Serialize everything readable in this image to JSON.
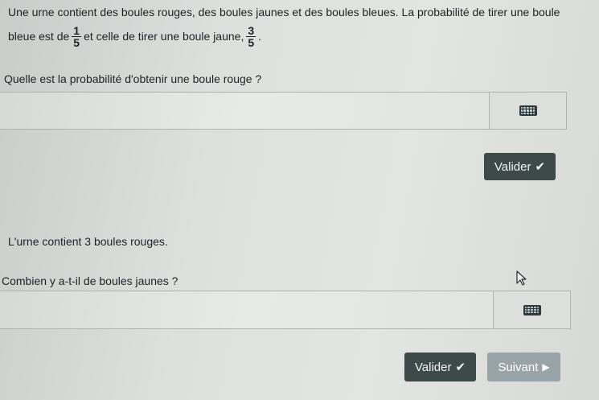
{
  "q1": {
    "line1": "Une urne contient des boules rouges, des boules jaunes et des boules bleues. La probabilité de tirer une boule",
    "line2_part1": "bleue est de",
    "frac1_num": "1",
    "frac1_den": "5",
    "line2_part2": "et celle de tirer une boule jaune,",
    "frac2_num": "3",
    "frac2_den": "5",
    "line2_end": ".",
    "question": "Quelle est la probabilité d'obtenir une boule rouge ?",
    "input_value": "",
    "validate_label": "Valider"
  },
  "q2": {
    "statement": "L'urne contient 3 boules rouges.",
    "question": "Combien y a-t-il de boules jaunes ?",
    "input_value": "",
    "validate_label": "Valider",
    "next_label": "Suivant"
  },
  "icons": {
    "keyboard": "keyboard-icon",
    "check": "check-icon",
    "next": "play-icon",
    "cursor": "mouse-pointer-icon"
  },
  "colors": {
    "button_dark": "#3e4a4a",
    "button_disabled": "#98a4a7"
  }
}
